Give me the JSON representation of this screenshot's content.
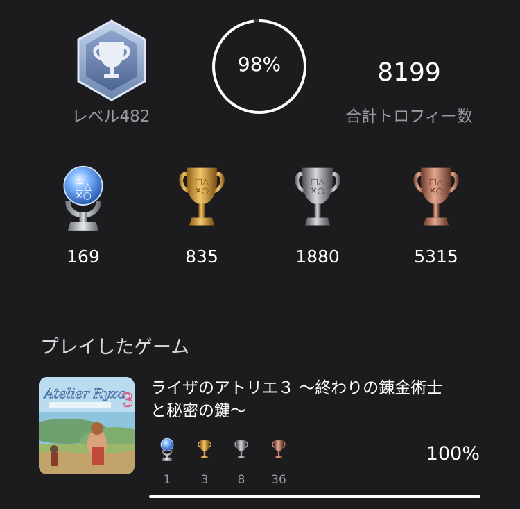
{
  "profile": {
    "level_label": "レベル482",
    "progress_text": "98%",
    "progress_fraction": 0.98,
    "total_trophies": "8199",
    "total_label": "合計トロフィー数"
  },
  "trophies": {
    "platinum": "169",
    "gold": "835",
    "silver": "1880",
    "bronze": "5315"
  },
  "section": {
    "title": "プレイしたゲーム"
  },
  "game": {
    "title_line1": "ライザのアトリエ３ 〜終わりの錬金術士",
    "title_line2": "と秘密の鍵〜",
    "platinum": "1",
    "gold": "3",
    "silver": "8",
    "bronze": "36",
    "percent": "100%",
    "progress_fraction": 1.0
  },
  "colors": {
    "background": "#1c1c1e",
    "muted_text": "#9a9aa0",
    "platinum": "#7fb6ff",
    "gold": "#d9a640",
    "silver": "#a8a8ae",
    "bronze": "#c07a63"
  },
  "icons": {
    "level_badge": "trophy-hexagon-badge-icon",
    "platinum": "platinum-trophy-icon",
    "gold": "gold-trophy-icon",
    "silver": "silver-trophy-icon",
    "bronze": "bronze-trophy-icon"
  }
}
